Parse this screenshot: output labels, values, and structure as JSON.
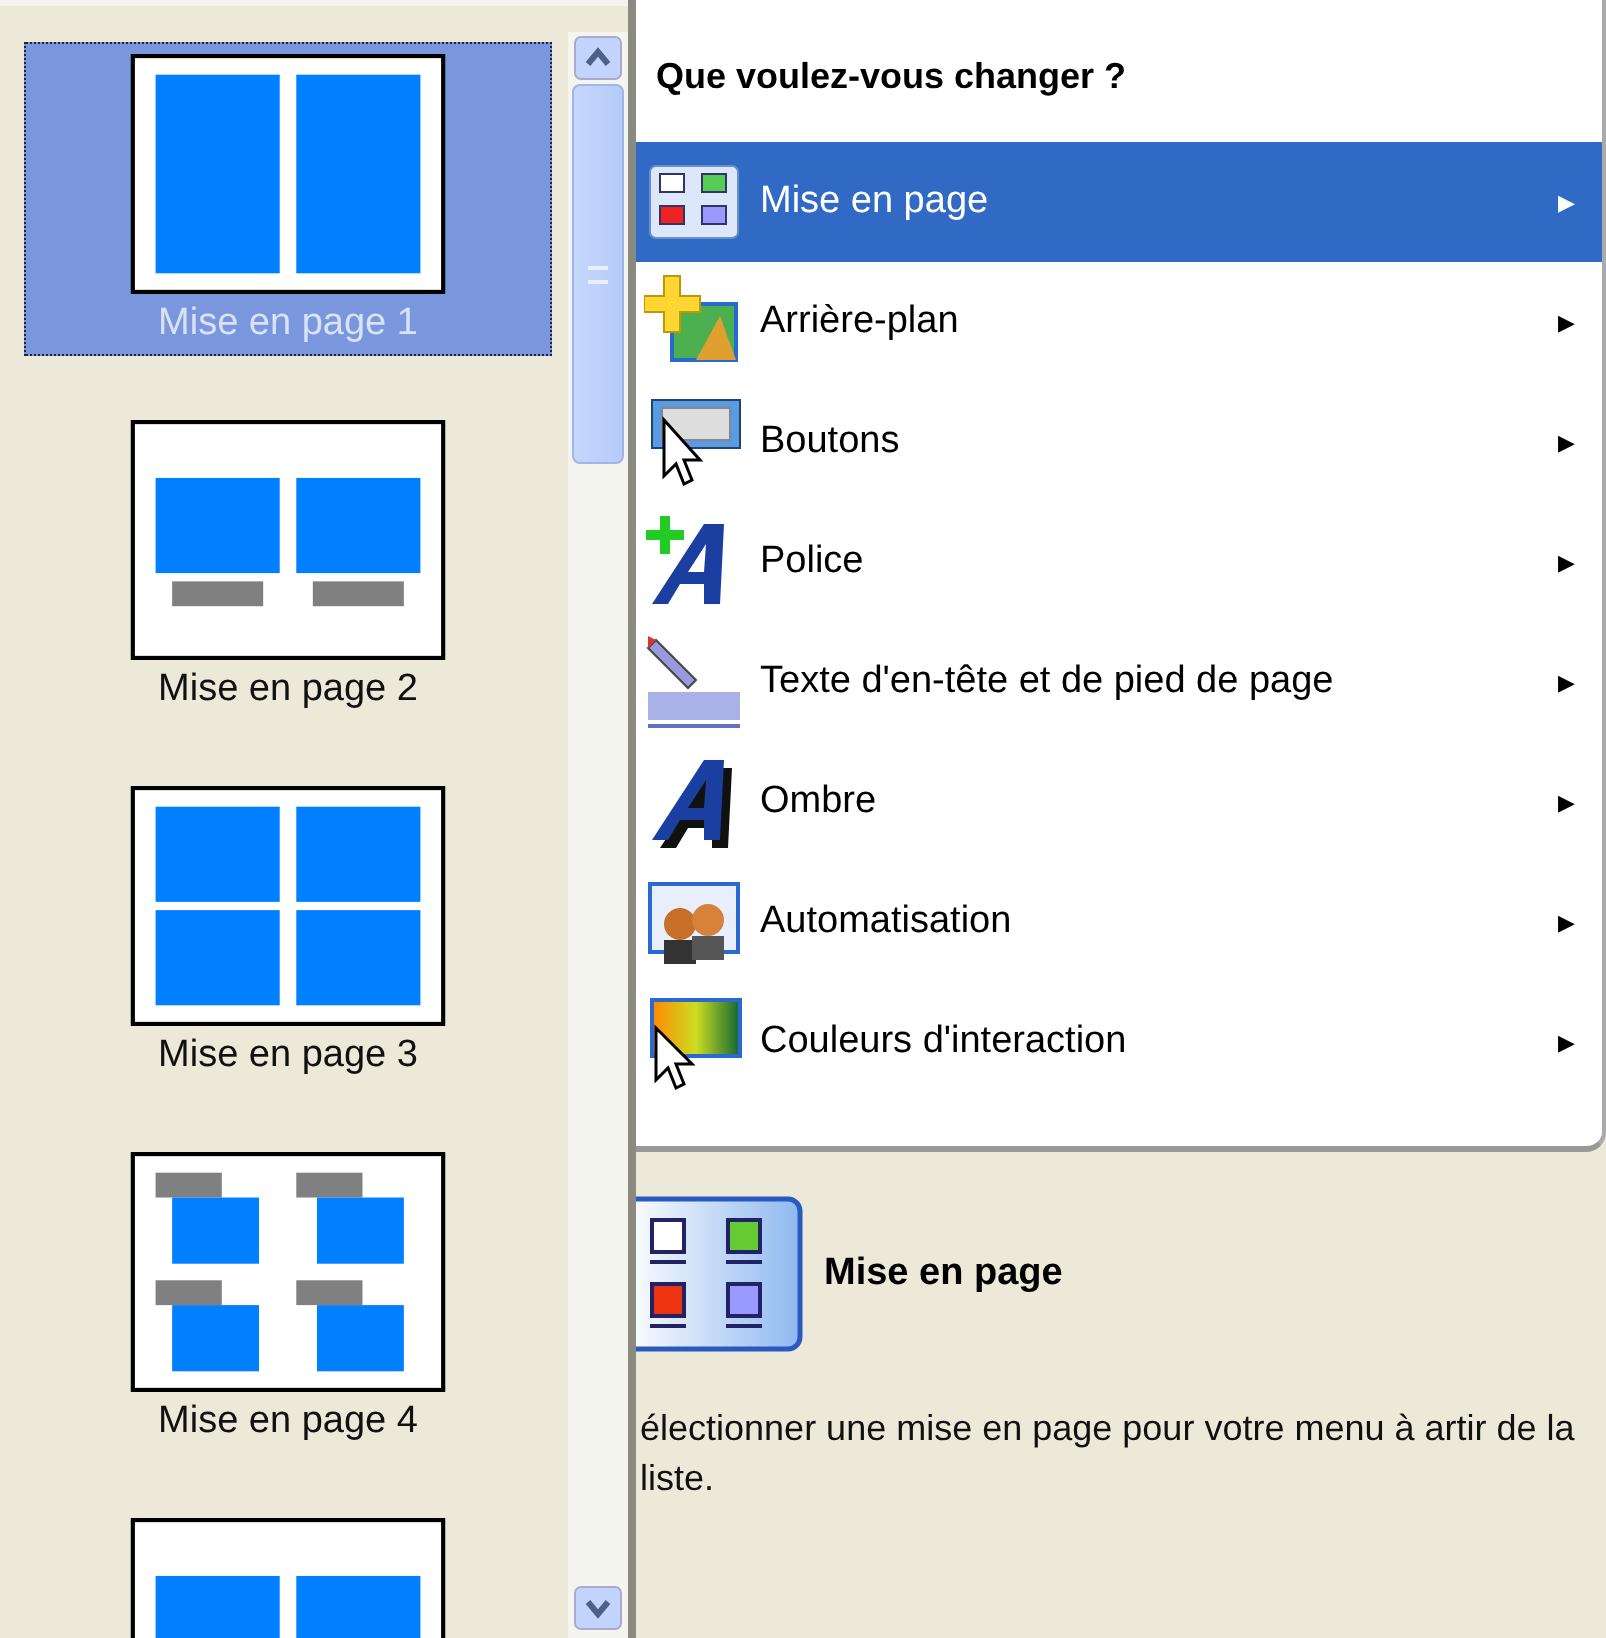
{
  "layouts": [
    {
      "label": "Mise en page 1",
      "kind": "two-columns",
      "selected": true
    },
    {
      "label": "Mise en page 2",
      "kind": "two-captioned",
      "selected": false
    },
    {
      "label": "Mise en page 3",
      "kind": "four-grid",
      "selected": false
    },
    {
      "label": "Mise en page 4",
      "kind": "four-tabbed",
      "selected": false
    },
    {
      "kind": "two-captioned",
      "selected": false
    }
  ],
  "menu": {
    "title": "Que voulez-vous changer ?",
    "items": [
      {
        "label": "Mise en page",
        "arrow": "▶",
        "selected": true
      },
      {
        "label": "Arrière-plan",
        "arrow": "▶",
        "selected": false
      },
      {
        "label": "Boutons",
        "arrow": "▶",
        "selected": false
      },
      {
        "label": "Police",
        "arrow": "▶",
        "selected": false
      },
      {
        "label": "Texte d'en-tête et de pied de page",
        "arrow": "▶",
        "selected": false
      },
      {
        "label": "Ombre",
        "arrow": "▶",
        "selected": false
      },
      {
        "label": "Automatisation",
        "arrow": "▶",
        "selected": false
      },
      {
        "label": "Couleurs d'interaction",
        "arrow": "▶",
        "selected": false
      }
    ]
  },
  "details": {
    "title": "Mise en page",
    "description": "électionner une mise en page pour votre menu à artir de la liste."
  }
}
